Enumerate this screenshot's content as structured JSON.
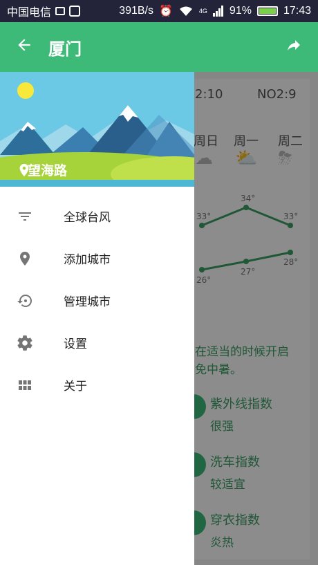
{
  "status_bar": {
    "carrier": "中国电信",
    "network_speed": "391B/s",
    "signal_badge": "4G",
    "battery": "91%",
    "time": "17:43"
  },
  "app_bar": {
    "title": "厦门"
  },
  "background": {
    "aqi_left": "2:10",
    "aqi_right": "NO2:9",
    "days": [
      "周日",
      "周一",
      "周二"
    ],
    "high_temps": [
      "33°",
      "34°",
      "33°"
    ],
    "low_temps": [
      "26°",
      "27°",
      "28°"
    ],
    "tip_line1": "在适当的时候开启",
    "tip_line2": "免中暑。",
    "indices": [
      {
        "title": "紫外线指数",
        "value": "很强"
      },
      {
        "title": "洗车指数",
        "value": "较适宜"
      },
      {
        "title": "穿衣指数",
        "value": "炎热"
      }
    ]
  },
  "drawer": {
    "location": "望海路",
    "menu": [
      {
        "label": "全球台风",
        "icon": "filter-icon"
      },
      {
        "label": "添加城市",
        "icon": "location-pin-icon"
      },
      {
        "label": "管理城市",
        "icon": "history-icon"
      },
      {
        "label": "设置",
        "icon": "gear-icon"
      },
      {
        "label": "关于",
        "icon": "grid-icon"
      }
    ]
  },
  "colors": {
    "primary": "#3dba78",
    "status_bar": "#23233a",
    "sky": "#6cc9e6",
    "grass": "#a6d23a"
  }
}
